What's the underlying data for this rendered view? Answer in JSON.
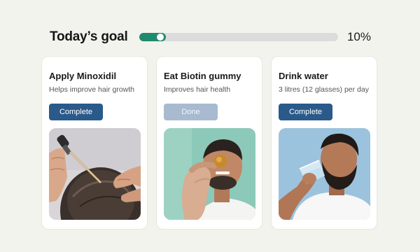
{
  "header": {
    "title": "Today’s goal",
    "progress_percent": 10,
    "progress_label": "10%",
    "accent_color": "#1f8a6e"
  },
  "tasks": [
    {
      "title": "Apply Minoxidil",
      "description": "Helps improve hair growth",
      "button_label": "Complete",
      "status": "pending",
      "image": "minoxidil-dropper-scalp-photo"
    },
    {
      "title": "Eat Biotin gummy",
      "description": "Improves hair health",
      "button_label": "Done",
      "status": "done",
      "image": "man-holding-gummy-photo"
    },
    {
      "title": "Drink water",
      "description": "3 litres (12 glasses) per day",
      "button_label": "Complete",
      "status": "pending",
      "image": "man-drinking-water-photo"
    }
  ],
  "colors": {
    "button_primary": "#2a5a8a",
    "button_done": "#a7bacf",
    "background": "#f3f3ee"
  }
}
